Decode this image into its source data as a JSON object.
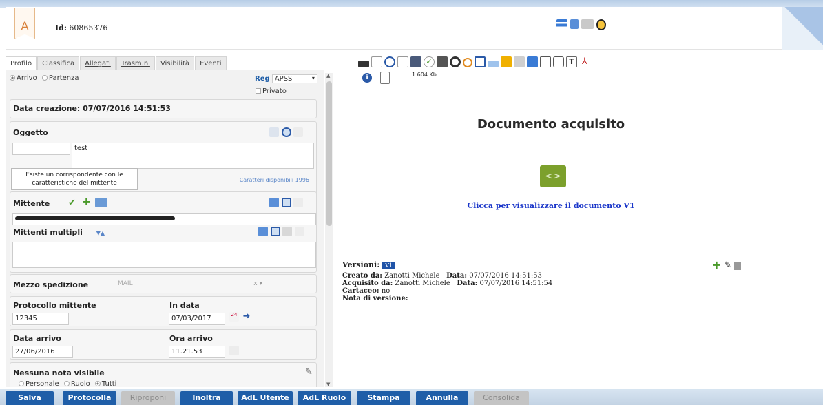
{
  "header": {
    "logo_letter": "A",
    "id_label": "Id:",
    "id_value": "60865376"
  },
  "tabs": [
    "Profilo",
    "Classifica",
    "Allegati",
    "Trasm.ni",
    "Visibilità",
    "Eventi"
  ],
  "profile": {
    "arrivo": "Arrivo",
    "partenza": "Partenza",
    "reg_label": "Reg",
    "reg_value": "APSS",
    "privato": "Privato",
    "data_creazione": "Data creazione: 07/07/2016 14:51:53",
    "oggetto_label": "Oggetto",
    "oggetto_value": "test",
    "tooltip": "Esiste un corrispondente con le caratteristiche del mittente",
    "caratteri": "Caratteri disponibili 1996",
    "mittente_label": "Mittente",
    "mittenti_multipli": "Mittenti multipli",
    "mezzo_label": "Mezzo spedizione",
    "mezzo_value": "MAIL",
    "mezzo_clear": "x",
    "protocollo_label": "Protocollo mittente",
    "protocollo_value": "12345",
    "in_data_label": "In data",
    "in_data_value": "07/03/2017",
    "data_arrivo_label": "Data arrivo",
    "data_arrivo_value": "27/06/2016",
    "ora_arrivo_label": "Ora arrivo",
    "ora_arrivo_value": "11.21.53",
    "nota_label": "Nessuna nota visibile",
    "nota_personale": "Personale",
    "nota_ruolo": "Ruolo",
    "nota_tutti": "Tutti"
  },
  "document": {
    "size": "1.604 Kb",
    "title": "Documento acquisito",
    "link": "Clicca per visualizzare il documento V1",
    "versioni_label": "Versioni:",
    "version": "V1",
    "creato_label": "Creato da:",
    "creato_value": "Zanotti Michele",
    "data_label": "Data:",
    "creato_data": "07/07/2016 14:51:53",
    "acquisito_label": "Acquisito da:",
    "acquisito_value": "Zanotti Michele",
    "acquisito_data": "07/07/2016 14:51:54",
    "cartaceo_label": "Cartaceo:",
    "cartaceo_value": "no",
    "nota_versione_label": "Nota di versione:"
  },
  "buttons": {
    "salva": "Salva",
    "protocolla": "Protocolla",
    "riproponi": "Riproponi",
    "inoltra": "Inoltra",
    "adl_utente": "AdL Utente",
    "adl_ruolo": "AdL Ruolo",
    "stampa": "Stampa",
    "annulla": "Annulla",
    "consolida": "Consolida"
  },
  "icons": [
    "save-icon",
    "print-icon",
    "search-icon",
    "zoom-icon",
    "signature-icon",
    "check-icon",
    "barcode-icon",
    "clock-icon",
    "stamp-icon",
    "lock-icon",
    "scan-icon",
    "text-icon",
    "pdf-icon",
    "info-icon",
    "clipboard-icon"
  ],
  "colors": {
    "primary_button": "#1f5ea8",
    "disabled_button": "#c4c4c4",
    "accent_green": "#7ca02c",
    "link": "#1a36c9"
  }
}
